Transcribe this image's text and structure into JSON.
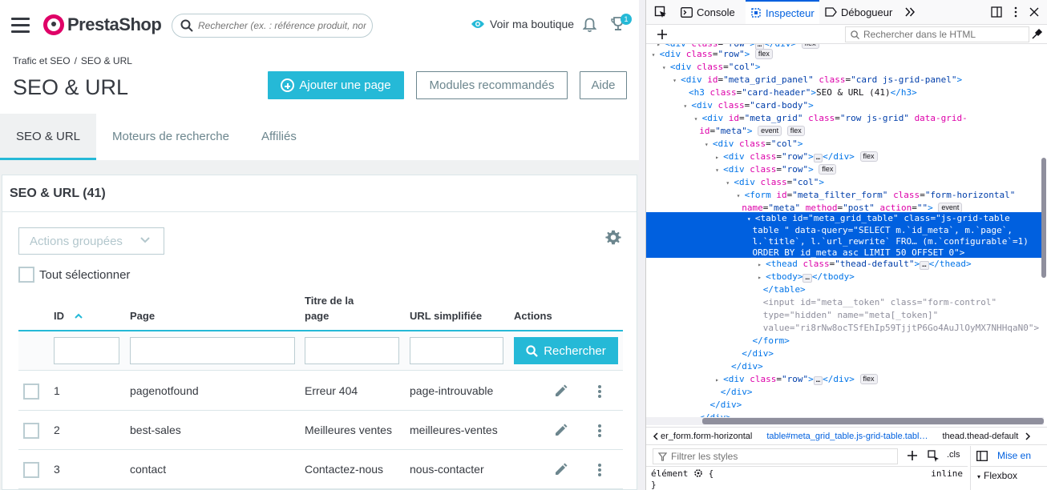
{
  "header": {
    "brand": "PrestaShop",
    "search_placeholder": "Rechercher (ex. : référence produit, nom",
    "view_shop": "Voir ma boutique",
    "notif_count": "1"
  },
  "page": {
    "breadcrumb": [
      "Trafic et SEO",
      "SEO & URL"
    ],
    "breadcrumb_sep": "/",
    "title": "SEO & URL",
    "add_button": "Ajouter une page",
    "modules_button": "Modules recommandés",
    "help_button": "Aide",
    "tabs": [
      "SEO & URL",
      "Moteurs de recherche",
      "Affiliés"
    ]
  },
  "grid": {
    "title": "SEO & URL (41)",
    "bulk_actions": "Actions groupées",
    "select_all": "Tout sélectionner",
    "columns": {
      "id": "ID",
      "page": "Page",
      "title_l1": "Titre de la",
      "title_l2": "page",
      "url": "URL simplifiée",
      "actions": "Actions"
    },
    "search_button": "Rechercher",
    "rows": [
      {
        "id": "1",
        "page": "pagenotfound",
        "title": "Erreur 404",
        "url": "page-introuvable"
      },
      {
        "id": "2",
        "page": "best-sales",
        "title": "Meilleures ventes",
        "url": "meilleures-ventes"
      },
      {
        "id": "3",
        "page": "contact",
        "title": "Contactez-nous",
        "url": "nous-contacter"
      }
    ]
  },
  "devtools": {
    "tabs": [
      "Console",
      "Inspecteur",
      "Débogueur"
    ],
    "html_search_placeholder": "Rechercher dans le HTML",
    "breadcrumb": [
      "er_form.form-horizontal",
      "table#meta_grid_table.js-grid-table.tabl…",
      "thead.thead-default"
    ],
    "filter_styles_placeholder": "Filtrer les styles",
    "cls": ".cls",
    "element_rule": "élément",
    "inline": "inline",
    "layout_tab": "Mise en",
    "flexbox": "Flexbox"
  },
  "colors": {
    "accent": "#25b9d7",
    "brand": "#df0067",
    "devtools_selection": "#0060df"
  }
}
